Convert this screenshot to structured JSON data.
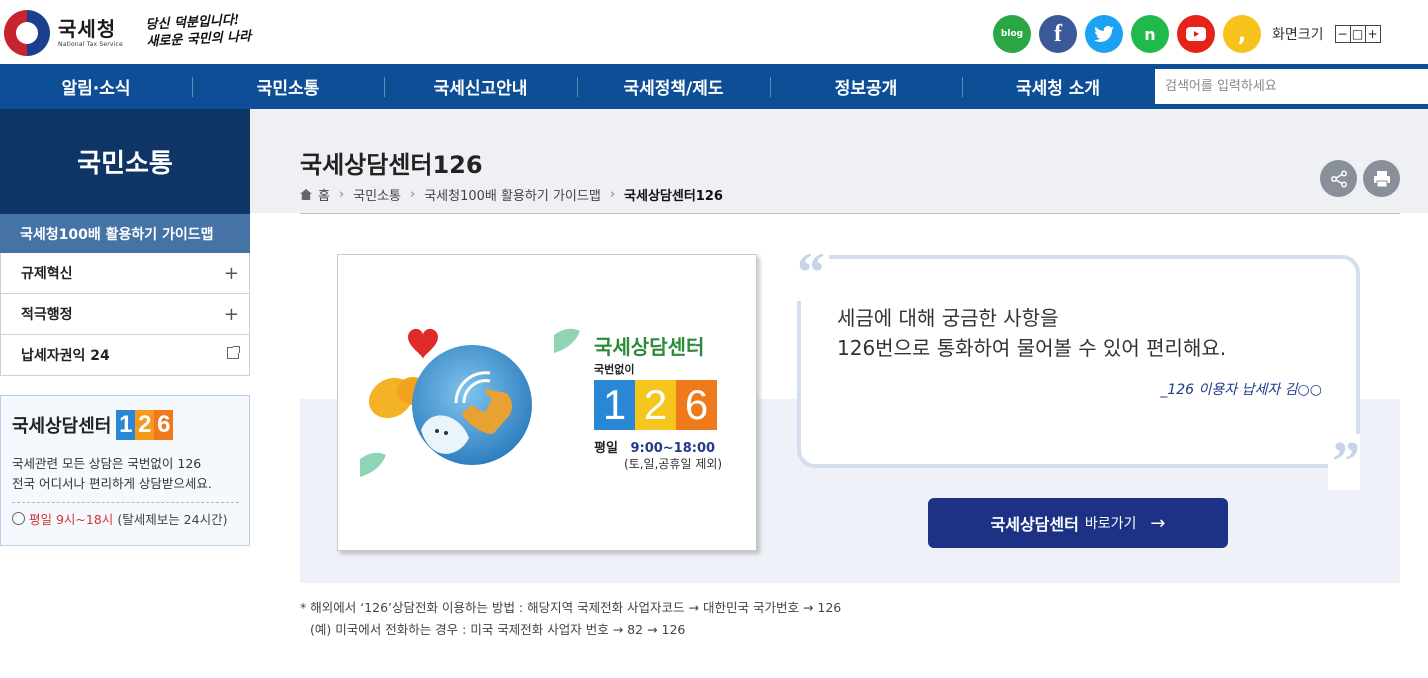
{
  "header": {
    "logo_kr": "국세청",
    "logo_en": "National Tax Service",
    "slogan_line1": "당신 덕분입니다!",
    "slogan_line2": "새로운 국민의 나라",
    "sns": [
      {
        "name": "blog-icon",
        "label": "blog"
      },
      {
        "name": "facebook-icon",
        "label": "f"
      },
      {
        "name": "twitter-icon",
        "label": "🐦"
      },
      {
        "name": "naver-post-icon",
        "label": "n"
      },
      {
        "name": "youtube-icon",
        "label": "▶"
      },
      {
        "name": "kakao-icon",
        "label": ","
      }
    ],
    "font_size_label": "화면크기",
    "font_btns": [
      "−",
      "□",
      "+"
    ]
  },
  "gnb": {
    "items": [
      "알림·소식",
      "국민소통",
      "국세신고안내",
      "국세정책/제도",
      "정보공개",
      "국세청 소개"
    ],
    "search_placeholder": "검색어를 입력하세요"
  },
  "lnb": {
    "title": "국민소통",
    "active": "국세청100배 활용하기 가이드맵",
    "items": [
      {
        "label": "규제혁신",
        "type": "expand"
      },
      {
        "label": "적극행정",
        "type": "expand"
      },
      {
        "label": "납세자권익 24",
        "type": "external"
      }
    ]
  },
  "side_box": {
    "title": "국세상담센터",
    "digits": [
      "1",
      "2",
      "6"
    ],
    "desc_line1": "국세관련 모든 상담은 국번없이 126",
    "desc_line2": "전국 어디서나 편리하게 상담받으세요.",
    "time_red": "평일 9시~18시",
    "time_rest": "(탈세제보는 24시간)"
  },
  "page": {
    "title": "국세상담센터126",
    "breadcrumb": [
      "홈",
      "국민소통",
      "국세청100배 활용하기 가이드맵",
      "국세상담센터126"
    ]
  },
  "card": {
    "brand": "국세상담센터",
    "nofix": "국번없이",
    "digits": [
      "1",
      "2",
      "6"
    ],
    "weekday": "평일",
    "hours": "9:00~18:00",
    "except": "(토,일,공휴일 제외)"
  },
  "quote": {
    "line1": "세금에 대해 궁금한 사항을",
    "line2": "126번으로 통화하여 물어볼 수 있어 편리해요.",
    "author": "_126 이용자 납세자 김○○"
  },
  "go_button": {
    "main": "국세상담센터",
    "sub": "바로가기",
    "arrow": "→"
  },
  "notes": {
    "line1": "* 해외에서 ‘126’상담전화 이용하는 방법 : 해당지역 국제전화 사업자코드 → 대한민국 국가번호 → 126",
    "line2": "(예) 미국에서 전화하는 경우 : 미국 국제전화 사업자 번호 → 82 → 126"
  },
  "colors": {
    "gnb": "#0e4e96",
    "lnb_head": "#0f3466",
    "lnb_active": "#4573a6",
    "button": "#1d3285"
  }
}
